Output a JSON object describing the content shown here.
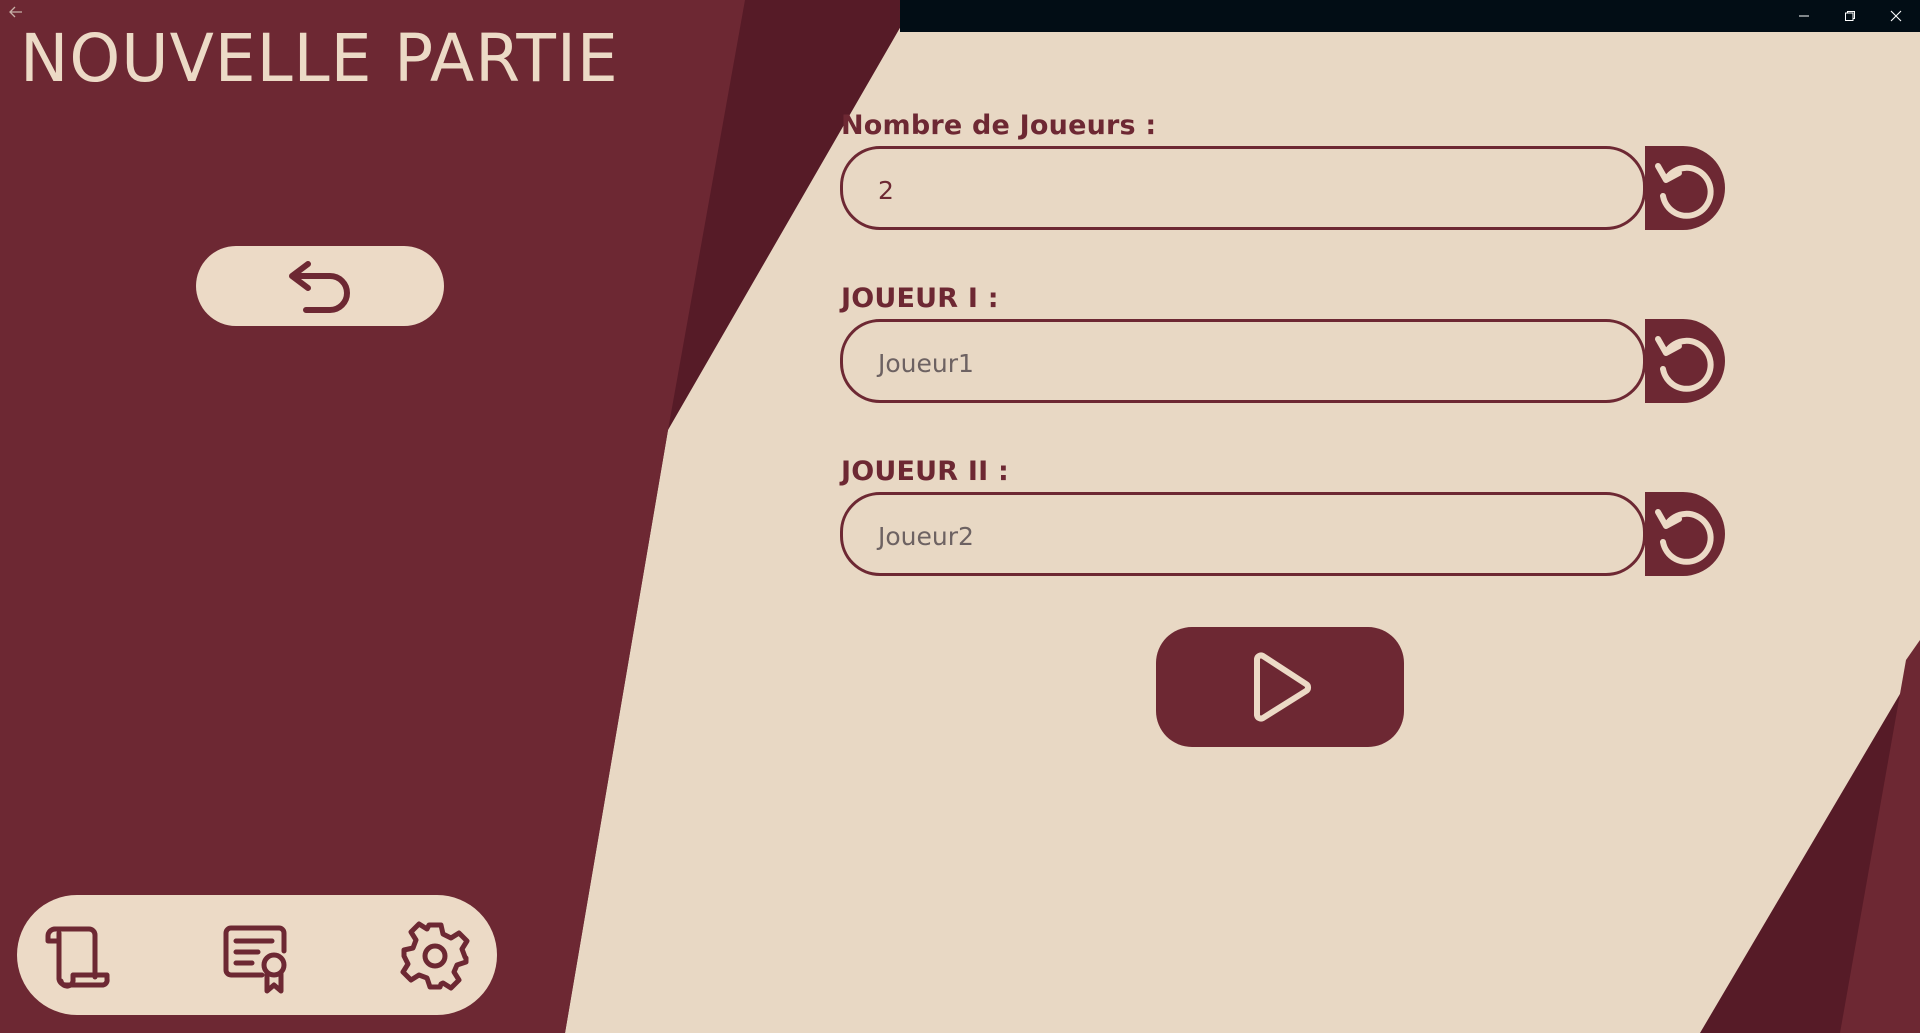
{
  "title": "NOUVELLE PARTIE",
  "colors": {
    "primary": "#6d2833",
    "dark": "#561b27",
    "cream": "#e8d8c4",
    "titlebar": "#020d15"
  },
  "titlebar": {
    "back_icon": "arrow-left-icon",
    "minimize_icon": "minimize-icon",
    "restore_icon": "restore-icon",
    "close_icon": "close-icon"
  },
  "sidebar": {
    "back_icon": "undo-arrow-icon",
    "bottom_icons": [
      "scroll-icon",
      "certificate-icon",
      "gear-icon"
    ]
  },
  "form": {
    "players_count": {
      "label": "Nombre de Joueurs :",
      "value": "2",
      "reset_icon": "reset-icon"
    },
    "player1": {
      "label": "JOUEUR I :",
      "placeholder": "Joueur1",
      "reset_icon": "reset-icon"
    },
    "player2": {
      "label": "JOUEUR II :",
      "placeholder": "Joueur2",
      "reset_icon": "reset-icon"
    }
  },
  "play_icon": "play-icon"
}
